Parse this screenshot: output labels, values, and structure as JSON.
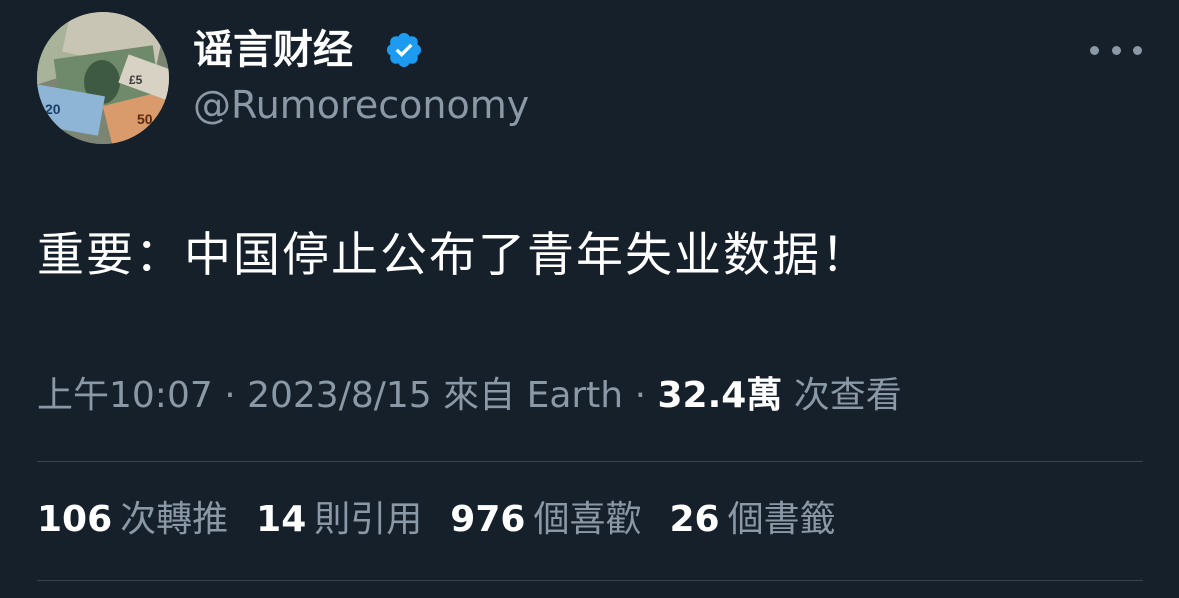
{
  "author": {
    "display_name": "谣言财经",
    "handle": "@Rumoreconomy",
    "verified": true,
    "verified_color": "#1d9bf0",
    "avatar_icon": "currency-banknotes-avatar"
  },
  "tweet": {
    "text": "重要：中国停止公布了青年失业数据！"
  },
  "meta": {
    "time": "上午10:07",
    "sep1": " · ",
    "date": "2023/8/15",
    "source": " 來自 Earth",
    "sep2": " · ",
    "views_count": "32.4萬",
    "views_label": " 次查看"
  },
  "stats": {
    "retweets": {
      "count": "106",
      "label": "次轉推"
    },
    "quotes": {
      "count": "14",
      "label": "則引用"
    },
    "likes": {
      "count": "976",
      "label": "個喜歡"
    },
    "bookmarks": {
      "count": "26",
      "label": "個書籤"
    }
  },
  "colors": {
    "background": "#15202b",
    "secondary_text": "#8b98a5",
    "divider": "#38444d"
  }
}
